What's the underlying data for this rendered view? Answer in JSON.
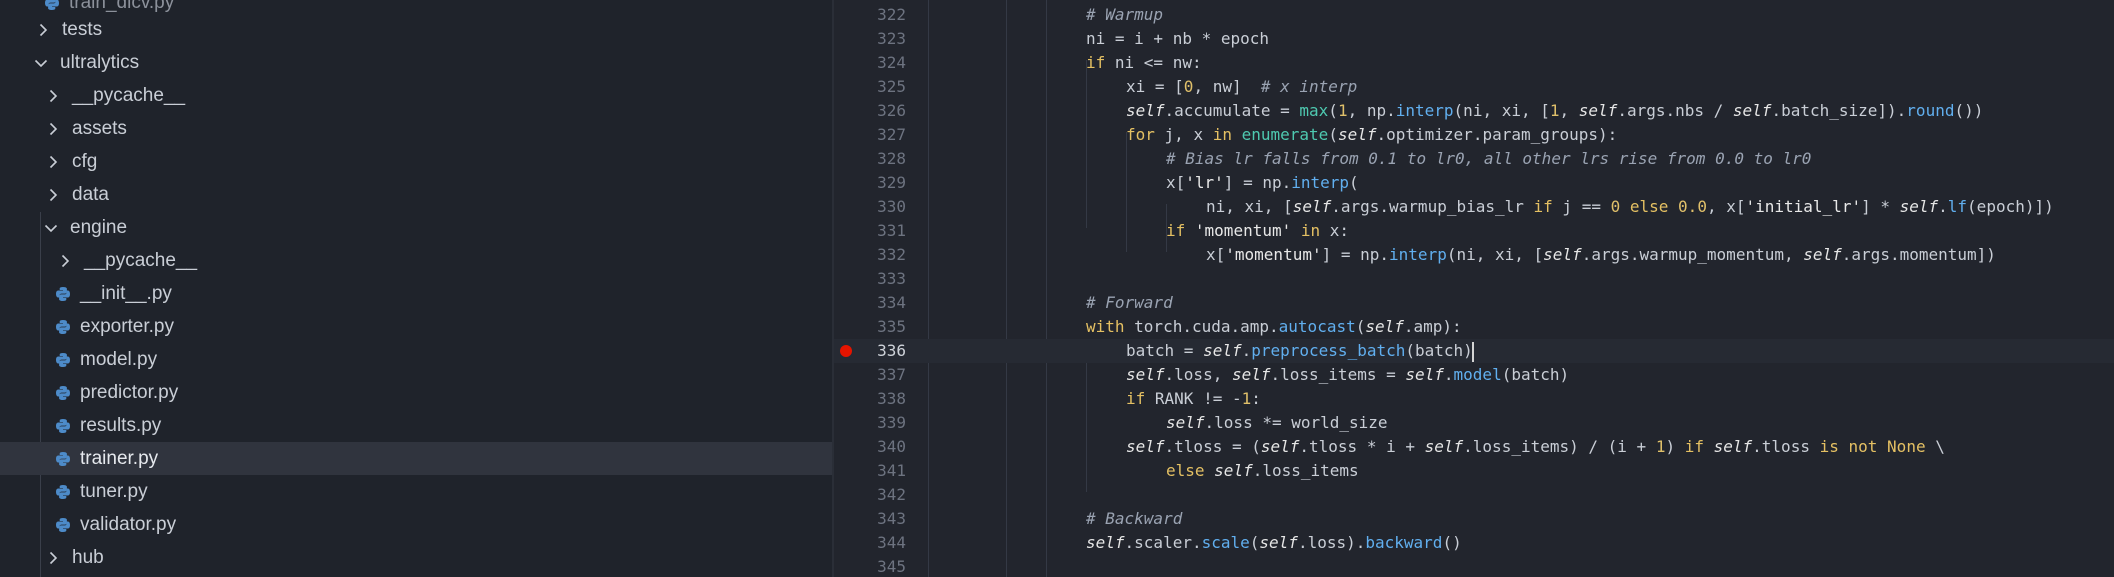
{
  "sidebar": {
    "items": [
      {
        "label": "train_dicv.py",
        "type": "file-partial"
      },
      {
        "label": "tests",
        "type": "folder",
        "expanded": false
      },
      {
        "label": "ultralytics",
        "type": "folder",
        "expanded": true
      },
      {
        "label": "__pycache__",
        "type": "folder",
        "expanded": false
      },
      {
        "label": "assets",
        "type": "folder",
        "expanded": false
      },
      {
        "label": "cfg",
        "type": "folder",
        "expanded": false
      },
      {
        "label": "data",
        "type": "folder",
        "expanded": false
      },
      {
        "label": "engine",
        "type": "folder",
        "expanded": true
      },
      {
        "label": "__pycache__",
        "type": "folder",
        "expanded": false
      },
      {
        "label": "__init__.py",
        "type": "python-file"
      },
      {
        "label": "exporter.py",
        "type": "python-file"
      },
      {
        "label": "model.py",
        "type": "python-file"
      },
      {
        "label": "predictor.py",
        "type": "python-file"
      },
      {
        "label": "results.py",
        "type": "python-file"
      },
      {
        "label": "trainer.py",
        "type": "python-file",
        "selected": true
      },
      {
        "label": "tuner.py",
        "type": "python-file"
      },
      {
        "label": "validator.py",
        "type": "python-file"
      },
      {
        "label": "hub",
        "type": "folder",
        "expanded": false
      }
    ]
  },
  "editor": {
    "breakpoint_line": "336",
    "active_line": "336",
    "lines": [
      {
        "n": "322",
        "code": "# Warmup"
      },
      {
        "n": "323",
        "code": "ni = i + nb * epoch"
      },
      {
        "n": "324",
        "code": "if ni <= nw:"
      },
      {
        "n": "325",
        "code": "xi = [0, nw]  # x interp"
      },
      {
        "n": "326",
        "code": "self.accumulate = max(1, np.interp(ni, xi, [1, self.args.nbs / self.batch_size]).round())"
      },
      {
        "n": "327",
        "code": "for j, x in enumerate(self.optimizer.param_groups):"
      },
      {
        "n": "328",
        "code": "# Bias lr falls from 0.1 to lr0, all other lrs rise from 0.0 to lr0"
      },
      {
        "n": "329",
        "code": "x['lr'] = np.interp("
      },
      {
        "n": "330",
        "code": "ni, xi, [self.args.warmup_bias_lr if j == 0 else 0.0, x['initial_lr'] * self.lf(epoch)])"
      },
      {
        "n": "331",
        "code": "if 'momentum' in x:"
      },
      {
        "n": "332",
        "code": "x['momentum'] = np.interp(ni, xi, [self.args.warmup_momentum, self.args.momentum])"
      },
      {
        "n": "333",
        "code": ""
      },
      {
        "n": "334",
        "code": "# Forward"
      },
      {
        "n": "335",
        "code": "with torch.cuda.amp.autocast(self.amp):"
      },
      {
        "n": "336",
        "code": "batch = self.preprocess_batch(batch)"
      },
      {
        "n": "337",
        "code": "self.loss, self.loss_items = self.model(batch)"
      },
      {
        "n": "338",
        "code": "if RANK != -1:"
      },
      {
        "n": "339",
        "code": "self.loss *= world_size"
      },
      {
        "n": "340",
        "code": "self.tloss = (self.tloss * i + self.loss_items) / (i + 1) if self.tloss is not None \\"
      },
      {
        "n": "341",
        "code": "else self.loss_items"
      },
      {
        "n": "342",
        "code": ""
      },
      {
        "n": "343",
        "code": "# Backward"
      },
      {
        "n": "344",
        "code": "self.scaler.scale(self.loss).backward()"
      },
      {
        "n": "345",
        "code": ""
      }
    ]
  },
  "colors": {
    "sidebar_bg": "#1f232b",
    "editor_bg": "#22252d",
    "selected_row": "#30343e",
    "breakpoint": "#e51400"
  }
}
